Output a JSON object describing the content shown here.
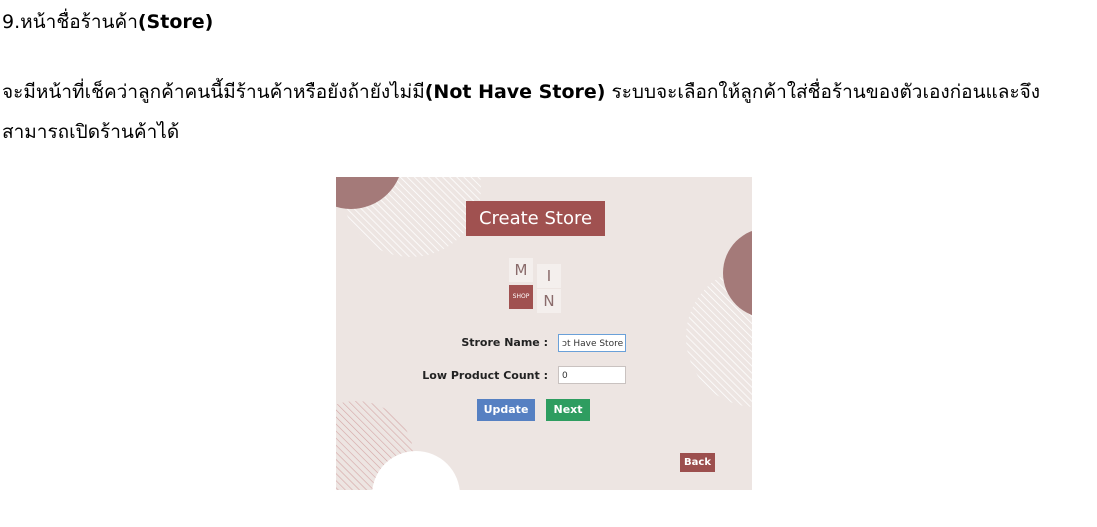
{
  "heading": {
    "number": "9.",
    "text": "หน้าชื่อร้านค้า",
    "bold": "(Store)"
  },
  "paragraph": {
    "part1": "จะมีหน้าที่เช็คว่าลูกค้าคนนี้มีร้านค้าหรือยังถ้ายังไม่มี",
    "bold": "(Not Have Store)",
    "part2": " ระบบจะเลือกให้ลูกค้าใส่ชื่อร้านของตัวเองก่อนและจึงสามารถเปิดร้านค้าได้"
  },
  "screenshot": {
    "title": "Create Store",
    "logo": {
      "m": "M",
      "i": "I",
      "n": "N",
      "shop": "SHOP"
    },
    "store_name_label": "Strore Name :",
    "store_name_value": "ɔt Have Store",
    "low_count_label": "Low Product Count :",
    "low_count_value": "0",
    "update_label": "Update",
    "next_label": "Next",
    "back_label": "Back"
  },
  "colors": {
    "panel_bg": "#ede5e2",
    "accent": "#a05150",
    "update": "#5680c2",
    "next": "#2e9d60"
  }
}
